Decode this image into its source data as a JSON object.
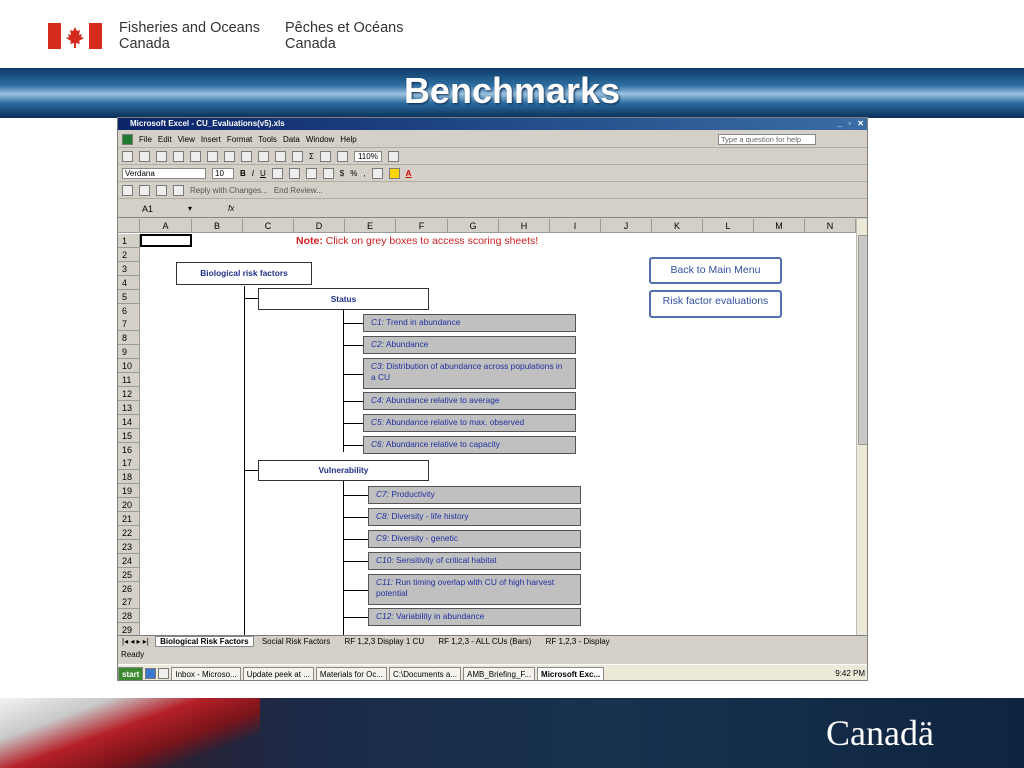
{
  "slide": {
    "dept_en": [
      "Fisheries and Oceans",
      "Canada"
    ],
    "dept_fr": [
      "Pêches et Océans",
      "Canada"
    ],
    "title": "Benchmarks",
    "wordmark": "Canadä"
  },
  "excel": {
    "window_title": "Microsoft Excel - CU_Evaluations(v5).xls",
    "menu": [
      "File",
      "Edit",
      "View",
      "Insert",
      "Format",
      "Tools",
      "Data",
      "Window",
      "Help"
    ],
    "question_placeholder": "Type a question for help",
    "zoom": "110%",
    "font_name": "Verdana",
    "font_size": "10",
    "reply_text": "Reply with Changes...",
    "end_review": "End Review...",
    "name_box": "A1",
    "fx": "fx",
    "columns": [
      "A",
      "B",
      "C",
      "D",
      "E",
      "F",
      "G",
      "H",
      "I",
      "J",
      "K",
      "L",
      "M",
      "N"
    ],
    "rows": [
      "1",
      "2",
      "3",
      "4",
      "5",
      "6",
      "7",
      "8",
      "9",
      "10",
      "11",
      "12",
      "13",
      "14",
      "15",
      "16",
      "17",
      "18",
      "19",
      "20",
      "21",
      "22",
      "23",
      "24",
      "25",
      "26",
      "27",
      "28",
      "29"
    ],
    "note_bold": "Note:",
    "note_text": " Click on grey boxes to access scoring sheets!",
    "bio_risk": "Biological risk factors",
    "status": "Status",
    "vulnerability": "Vulnerability",
    "criteria": [
      {
        "code": "C1:",
        "text": " Trend in abundance"
      },
      {
        "code": "C2:",
        "text": " Abundance"
      },
      {
        "code": "C3",
        "text": ": Distribution of abundance across populations in a CU"
      },
      {
        "code": "C4:",
        "text": " Abundance relative to average"
      },
      {
        "code": "C5:",
        "text": " Abundance relative to max. observed"
      },
      {
        "code": "C6:",
        "text": " Abundance relative to capacity"
      },
      {
        "code": "C7:",
        "text": " Productivity"
      },
      {
        "code": "C8:",
        "text": " Diversity - life history"
      },
      {
        "code": "C9:",
        "text": " Diversity - genetic"
      },
      {
        "code": "C10:",
        "text": " Sensitivity of critical habitat"
      },
      {
        "code": "C11:",
        "text": " Run timing overlap with CU of high harvest potential"
      },
      {
        "code": "C12:",
        "text": " Variability in abundance"
      }
    ],
    "back_btn": "Back to Main Menu",
    "risk_btn": "Risk factor evaluations",
    "sheet_tabs": [
      "Biological Risk Factors",
      "Social Risk Factors",
      "RF 1,2,3 Display 1 CU",
      "RF 1,2,3 - ALL CUs (Bars)",
      "RF 1,2,3 - Display"
    ],
    "status_text": "Ready",
    "taskbar": {
      "start": "start",
      "items": [
        "Inbox - Microso...",
        "Update peek at ...",
        "Materials for Oc...",
        "C:\\Documents a...",
        "AMB_Briefing_F...",
        "Microsoft Exc..."
      ],
      "clock": "9:42 PM"
    }
  },
  "colors": {
    "flag_red": "#d52b1e",
    "box_text": "#2030a0",
    "note_red": "#d02020"
  }
}
